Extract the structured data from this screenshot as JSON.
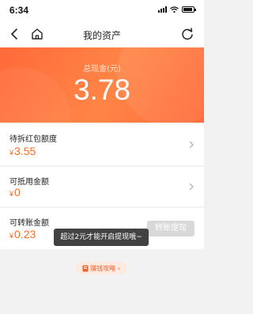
{
  "status_bar": {
    "time": "6:34"
  },
  "nav": {
    "title": "我的资产"
  },
  "hero": {
    "label": "总现金(元)",
    "amount": "3.78"
  },
  "rows": [
    {
      "title": "待拆红包额度",
      "currency": "¥",
      "value": "3.55"
    },
    {
      "title": "可抵用金额",
      "currency": "¥",
      "value": "0"
    },
    {
      "title": "可转账金额",
      "currency": "¥",
      "value": "0.23"
    }
  ],
  "withdraw_button": {
    "label": "转账提现"
  },
  "toast": {
    "message": "超过2元才能开启提现哦~"
  },
  "guide": {
    "label": "赚钱攻略 ›"
  },
  "colors": {
    "accent": "#ff6a1a",
    "hero_gradient_start": "#ff6a3a",
    "hero_gradient_end": "#ff8546"
  },
  "icons": [
    "back-icon",
    "home-icon",
    "refresh-icon",
    "chevron-right-icon",
    "signal-icon",
    "wifi-icon",
    "battery-icon",
    "guide-book-icon"
  ]
}
